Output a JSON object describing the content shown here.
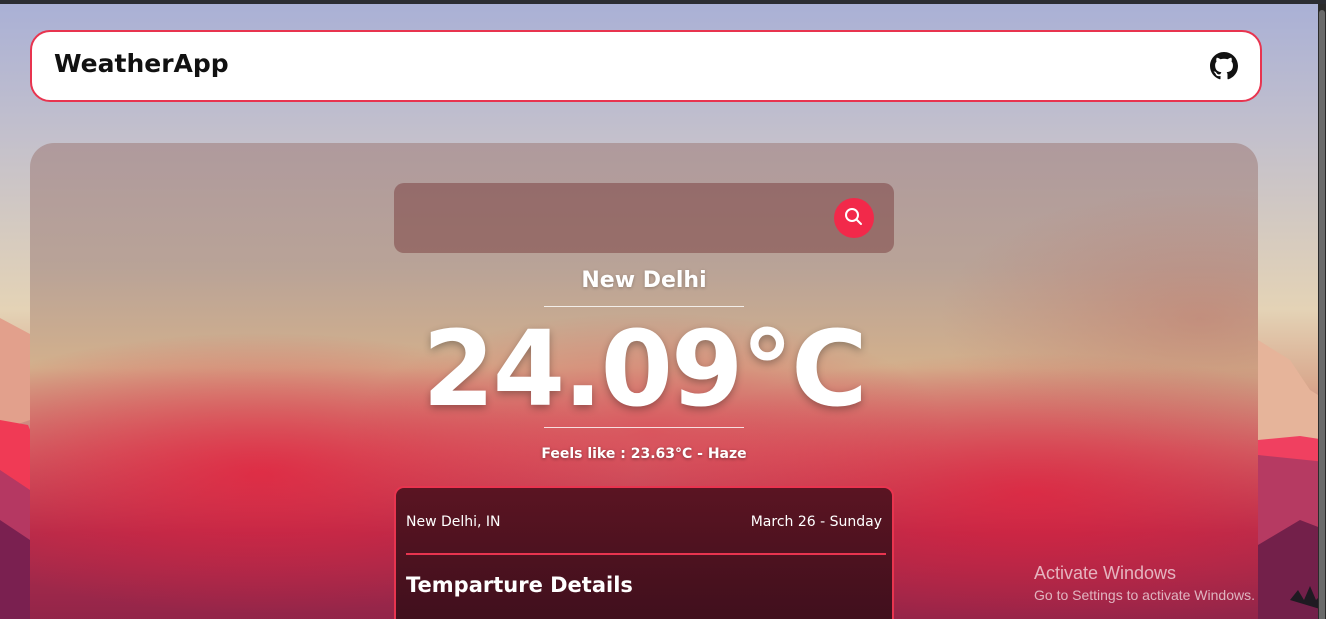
{
  "navbar": {
    "brand": "WeatherApp",
    "github_icon": "github-icon"
  },
  "search": {
    "placeholder": "",
    "value": "",
    "button_icon": "search-icon"
  },
  "weather": {
    "city": "New Delhi",
    "temperature": "24.09°C",
    "feels_like": "Feels like : 23.63°C - Haze"
  },
  "details": {
    "location": "New Delhi, IN",
    "date": "March 26 - Sunday",
    "title": "Temparture Details"
  },
  "os_overlay": {
    "line1": "Activate Windows",
    "line2": "Go to Settings to activate Windows."
  },
  "colors": {
    "accent": "#e8344f",
    "search_button": "#f2294a"
  }
}
